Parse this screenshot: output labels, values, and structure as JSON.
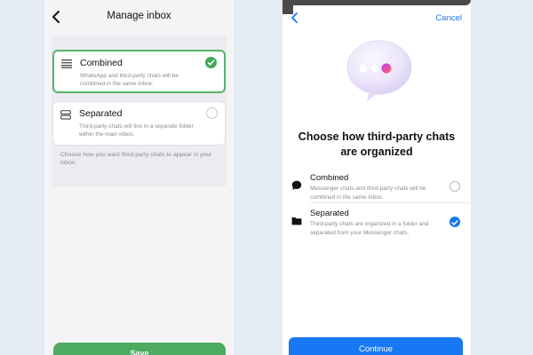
{
  "left_screen": {
    "title": "Manage inbox",
    "options": [
      {
        "label": "Combined",
        "description": "WhatsApp and third-party chats will be combined in the same inbox.",
        "selected": true
      },
      {
        "label": "Separated",
        "description": "Third-party chats will live in a separate folder within the main inbox.",
        "selected": false
      }
    ],
    "help_text": "Choose how you want third-party chats to appear in your inbox.",
    "save_label": "Save",
    "accent_color": "#3fa855"
  },
  "right_screen": {
    "cancel_label": "Cancel",
    "headline": "Choose how third-party chats are organized",
    "options": [
      {
        "label": "Combined",
        "description": "Messenger chats and third-party chats will be combined in the same inbox.",
        "icon": "chat-bubble-icon",
        "selected": false
      },
      {
        "label": "Separated",
        "description": "Third-party chats are organized in a folder and separated from your Messenger chats.",
        "icon": "folder-icon",
        "selected": true
      }
    ],
    "continue_label": "Continue",
    "accent_color": "#1877f2"
  }
}
